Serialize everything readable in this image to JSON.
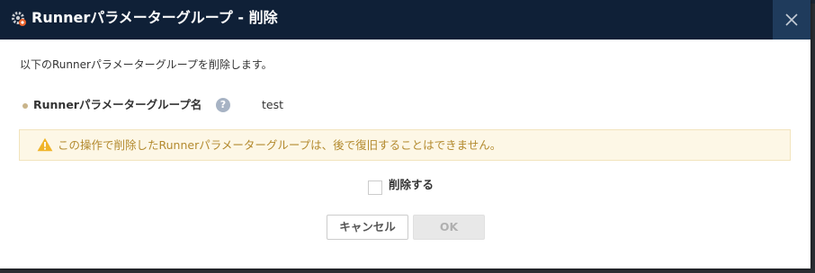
{
  "dialog": {
    "title": "Runnerパラメーターグループ - 削除",
    "title_icon": "gear-icon",
    "close_icon": "close-icon",
    "description": "以下のRunnerパラメーターグループを削除します。",
    "field": {
      "label": "Runnerパラメーターグループ名",
      "help_icon": "help-icon",
      "help_glyph": "?",
      "value": "test"
    },
    "warning": {
      "icon": "warning-icon",
      "text": "この操作で削除したRunnerパラメーターグループは、後で復旧することはできません。"
    },
    "confirm": {
      "label": "削除する",
      "checked": false
    },
    "buttons": {
      "cancel_label": "キャンセル",
      "ok_label": "OK"
    }
  },
  "colors": {
    "titlebar_bg": "#0f2037",
    "close_bg": "#1f3b5c",
    "warning_bg": "#fdf7e6",
    "warning_text": "#b38a2e",
    "warning_icon": "#f0b429",
    "bullet": "#c9b48a",
    "help_icon_bg": "#a7b3c4"
  }
}
